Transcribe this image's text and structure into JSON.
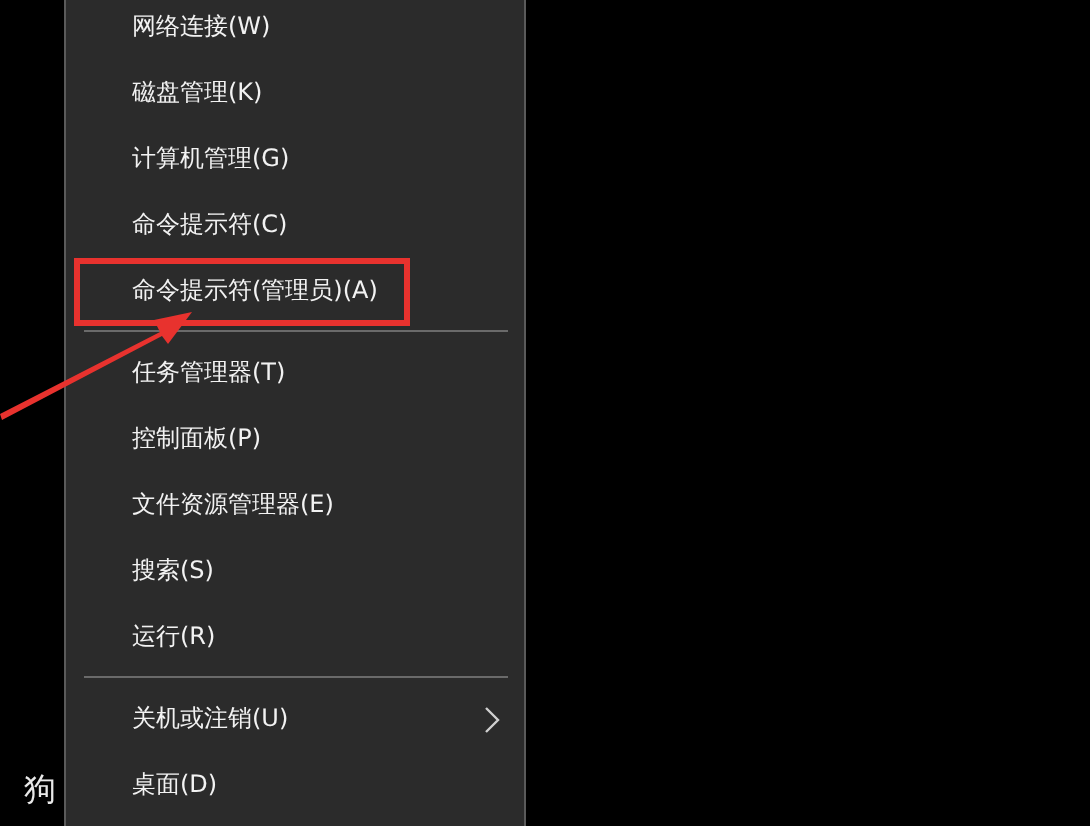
{
  "background_text": "狗",
  "menu": {
    "sections": [
      {
        "items": [
          {
            "label": "网络连接(W)",
            "submenu": false,
            "annotated": false
          },
          {
            "label": "磁盘管理(K)",
            "submenu": false,
            "annotated": false
          },
          {
            "label": "计算机管理(G)",
            "submenu": false,
            "annotated": false
          },
          {
            "label": "命令提示符(C)",
            "submenu": false,
            "annotated": false
          },
          {
            "label": "命令提示符(管理员)(A)",
            "submenu": false,
            "annotated": true
          }
        ]
      },
      {
        "items": [
          {
            "label": "任务管理器(T)",
            "submenu": false,
            "annotated": false
          },
          {
            "label": "控制面板(P)",
            "submenu": false,
            "annotated": false
          },
          {
            "label": "文件资源管理器(E)",
            "submenu": false,
            "annotated": false
          },
          {
            "label": "搜索(S)",
            "submenu": false,
            "annotated": false
          },
          {
            "label": "运行(R)",
            "submenu": false,
            "annotated": false
          }
        ]
      },
      {
        "items": [
          {
            "label": "关机或注销(U)",
            "submenu": true,
            "annotated": false
          },
          {
            "label": "桌面(D)",
            "submenu": false,
            "annotated": false
          }
        ]
      }
    ]
  }
}
